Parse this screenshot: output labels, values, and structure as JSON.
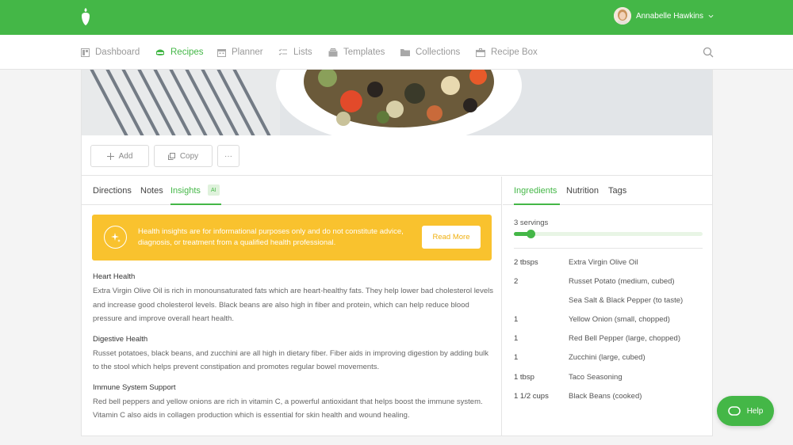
{
  "user": {
    "name": "Annabelle Hawkins"
  },
  "nav": {
    "items": [
      {
        "label": "Dashboard",
        "icon": "dashboard-icon"
      },
      {
        "label": "Recipes",
        "icon": "recipes-icon"
      },
      {
        "label": "Planner",
        "icon": "calendar-icon"
      },
      {
        "label": "Lists",
        "icon": "list-icon"
      },
      {
        "label": "Templates",
        "icon": "templates-icon"
      },
      {
        "label": "Collections",
        "icon": "folder-icon"
      },
      {
        "label": "Recipe Box",
        "icon": "box-icon"
      }
    ],
    "active": "Recipes"
  },
  "toolbar": {
    "add_label": "Add",
    "copy_label": "Copy",
    "more_label": "···"
  },
  "left_tabs": {
    "directions": "Directions",
    "notes": "Notes",
    "insights": "Insights",
    "ai_badge": "AI"
  },
  "right_tabs": {
    "ingredients": "Ingredients",
    "nutrition": "Nutrition",
    "tags": "Tags"
  },
  "banner": {
    "text": "Health insights are for informational purposes only and do not constitute advice, diagnosis, or treatment from a qualified health professional.",
    "button": "Read More"
  },
  "insights": [
    {
      "title": "Heart Health",
      "body": "Extra Virgin Olive Oil is rich in monounsaturated fats which are heart-healthy fats. They help lower bad cholesterol levels and increase good cholesterol levels. Black beans are also high in fiber and protein, which can help reduce blood pressure and improve overall heart health."
    },
    {
      "title": "Digestive Health",
      "body": "Russet potatoes, black beans, and zucchini are all high in dietary fiber. Fiber aids in improving digestion by adding bulk to the stool which helps prevent constipation and promotes regular bowel movements."
    },
    {
      "title": "Immune System Support",
      "body": "Red bell peppers and yellow onions are rich in vitamin C, a powerful antioxidant that helps boost the immune system. Vitamin C also aids in collagen production which is essential for skin health and wound healing."
    }
  ],
  "servings": {
    "label": "3 servings",
    "slider_fraction": 0.09
  },
  "ingredients": [
    {
      "qty": "2 tbsps",
      "name": "Extra Virgin Olive Oil"
    },
    {
      "qty": "2",
      "name": "Russet Potato (medium, cubed)"
    },
    {
      "qty": "",
      "name": "Sea Salt & Black Pepper (to taste)"
    },
    {
      "qty": "1",
      "name": "Yellow Onion (small, chopped)"
    },
    {
      "qty": "1",
      "name": "Red Bell Pepper (large, chopped)"
    },
    {
      "qty": "1",
      "name": "Zucchini (large, cubed)"
    },
    {
      "qty": "1 tbsp",
      "name": "Taco Seasoning"
    },
    {
      "qty": "1 1/2 cups",
      "name": "Black Beans (cooked)"
    }
  ],
  "help": {
    "label": "Help"
  },
  "colors": {
    "brand": "#44b747",
    "banner": "#f9c22e"
  }
}
